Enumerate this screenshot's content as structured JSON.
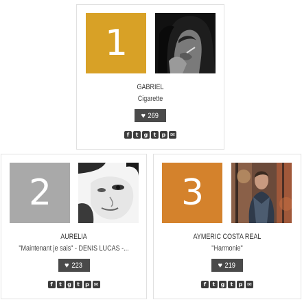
{
  "colors": {
    "rank1": "#d8a126",
    "rank2": "#a9a9a9",
    "rank3": "#d4822c",
    "likes_bg": "#4a4a4a",
    "share_bg": "#3c3c3c"
  },
  "share_icons": [
    {
      "name": "facebook-icon",
      "glyph": "f"
    },
    {
      "name": "twitter-icon",
      "glyph": "t"
    },
    {
      "name": "google-plus-icon",
      "glyph": "g"
    },
    {
      "name": "tumblr-icon",
      "glyph": "t"
    },
    {
      "name": "pinterest-icon",
      "glyph": "p"
    },
    {
      "name": "email-icon",
      "glyph": "✉"
    }
  ],
  "entries": [
    {
      "rank": "1",
      "artist": "GABRIEL",
      "song": "Cigarette",
      "likes": "269"
    },
    {
      "rank": "2",
      "artist": "AURELIA",
      "song": "\"Maintenant je sais\" - DENIS LUCAS -...",
      "likes": "223"
    },
    {
      "rank": "3",
      "artist": "AYMERIC COSTA REAL",
      "song": "\"Harmonie\"",
      "likes": "219"
    }
  ]
}
